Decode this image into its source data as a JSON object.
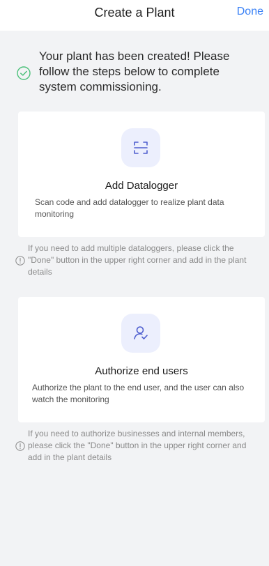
{
  "header": {
    "title": "Create a Plant",
    "done_label": "Done"
  },
  "success": {
    "icon": "check-circle-icon",
    "message": "Your plant has been created! Please follow the steps below to complete system commissioning.",
    "color": "#4cc17a"
  },
  "cards": [
    {
      "icon": "scan-icon",
      "title": "Add Datalogger",
      "description": "Scan code and add datalogger to realize plant data monitoring"
    },
    {
      "icon": "user-check-icon",
      "title": "Authorize end users",
      "description": "Authorize the plant to the end user, and the user can also watch the monitoring"
    }
  ],
  "notes": [
    {
      "icon": "info-circle-icon",
      "text": "If you need to add multiple dataloggers, please click the \"Done\" button in the upper right corner and add in the plant details"
    },
    {
      "icon": "info-circle-icon",
      "text": "If you need to authorize businesses and internal members, please click the \"Done\" button in the upper right corner and add in the plant details"
    }
  ],
  "colors": {
    "accent": "#3b82f6",
    "icon_bg": "#eceffd",
    "icon_stroke": "#4f5fcf",
    "background": "#f2f3f5"
  }
}
